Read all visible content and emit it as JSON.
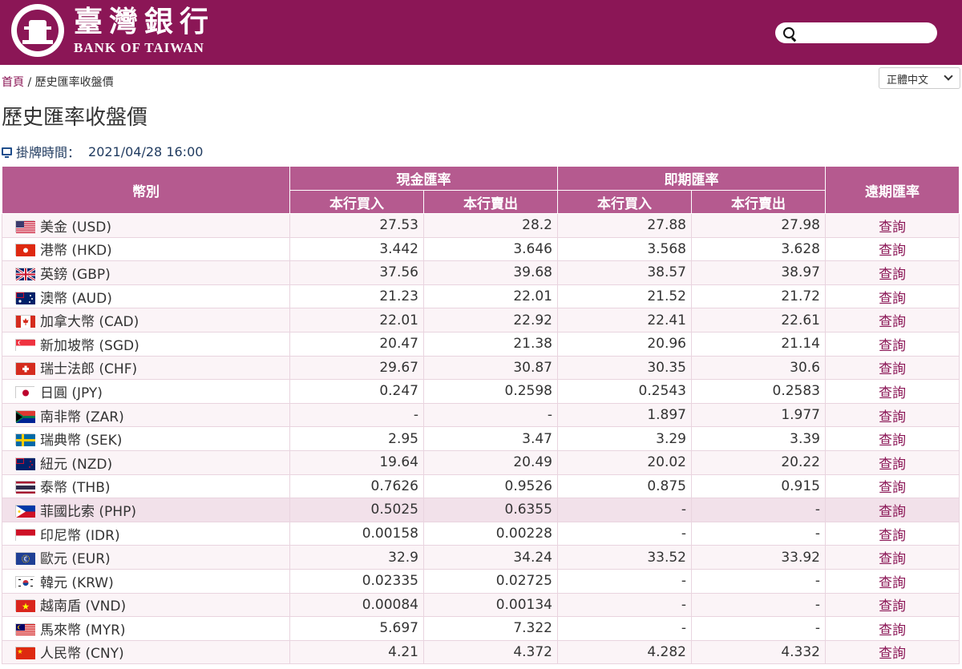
{
  "header": {
    "logo_cn": "臺灣銀行",
    "logo_en": "BANK OF TAIWAN",
    "search_placeholder": ""
  },
  "breadcrumb": {
    "home": "首頁",
    "separator": "/",
    "current": "歷史匯率收盤價"
  },
  "language": "正體中文",
  "page_title": "歷史匯率收盤價",
  "timestamp": {
    "label": "掛牌時間：",
    "value": "2021/04/28 16:00"
  },
  "table": {
    "headers": {
      "currency": "幣別",
      "cash": "現金匯率",
      "spot": "即期匯率",
      "forward": "遠期匯率",
      "buy": "本行買入",
      "sell": "本行賣出"
    },
    "rows": [
      {
        "flag": "us",
        "name": "美金 (USD)",
        "cash_buy": "27.53",
        "cash_sell": "28.2",
        "spot_buy": "27.88",
        "spot_sell": "27.98",
        "forward": "查詢"
      },
      {
        "flag": "hk",
        "name": "港幣 (HKD)",
        "cash_buy": "3.442",
        "cash_sell": "3.646",
        "spot_buy": "3.568",
        "spot_sell": "3.628",
        "forward": "查詢"
      },
      {
        "flag": "gb",
        "name": "英鎊 (GBP)",
        "cash_buy": "37.56",
        "cash_sell": "39.68",
        "spot_buy": "38.57",
        "spot_sell": "38.97",
        "forward": "查詢"
      },
      {
        "flag": "au",
        "name": "澳幣 (AUD)",
        "cash_buy": "21.23",
        "cash_sell": "22.01",
        "spot_buy": "21.52",
        "spot_sell": "21.72",
        "forward": "查詢"
      },
      {
        "flag": "ca",
        "name": "加拿大幣 (CAD)",
        "cash_buy": "22.01",
        "cash_sell": "22.92",
        "spot_buy": "22.41",
        "spot_sell": "22.61",
        "forward": "查詢"
      },
      {
        "flag": "sg",
        "name": "新加坡幣 (SGD)",
        "cash_buy": "20.47",
        "cash_sell": "21.38",
        "spot_buy": "20.96",
        "spot_sell": "21.14",
        "forward": "查詢"
      },
      {
        "flag": "ch",
        "name": "瑞士法郎 (CHF)",
        "cash_buy": "29.67",
        "cash_sell": "30.87",
        "spot_buy": "30.35",
        "spot_sell": "30.6",
        "forward": "查詢"
      },
      {
        "flag": "jp",
        "name": "日圓 (JPY)",
        "cash_buy": "0.247",
        "cash_sell": "0.2598",
        "spot_buy": "0.2543",
        "spot_sell": "0.2583",
        "forward": "查詢"
      },
      {
        "flag": "za",
        "name": "南非幣 (ZAR)",
        "cash_buy": "-",
        "cash_sell": "-",
        "spot_buy": "1.897",
        "spot_sell": "1.977",
        "forward": "查詢"
      },
      {
        "flag": "se",
        "name": "瑞典幣 (SEK)",
        "cash_buy": "2.95",
        "cash_sell": "3.47",
        "spot_buy": "3.29",
        "spot_sell": "3.39",
        "forward": "查詢"
      },
      {
        "flag": "nz",
        "name": "紐元 (NZD)",
        "cash_buy": "19.64",
        "cash_sell": "20.49",
        "spot_buy": "20.02",
        "spot_sell": "20.22",
        "forward": "查詢"
      },
      {
        "flag": "th",
        "name": "泰幣 (THB)",
        "cash_buy": "0.7626",
        "cash_sell": "0.9526",
        "spot_buy": "0.875",
        "spot_sell": "0.915",
        "forward": "查詢"
      },
      {
        "flag": "ph",
        "name": "菲國比索 (PHP)",
        "cash_buy": "0.5025",
        "cash_sell": "0.6355",
        "spot_buy": "-",
        "spot_sell": "-",
        "forward": "查詢"
      },
      {
        "flag": "id",
        "name": "印尼幣 (IDR)",
        "cash_buy": "0.00158",
        "cash_sell": "0.00228",
        "spot_buy": "-",
        "spot_sell": "-",
        "forward": "查詢"
      },
      {
        "flag": "eu",
        "name": "歐元 (EUR)",
        "cash_buy": "32.9",
        "cash_sell": "34.24",
        "spot_buy": "33.52",
        "spot_sell": "33.92",
        "forward": "查詢"
      },
      {
        "flag": "kr",
        "name": "韓元 (KRW)",
        "cash_buy": "0.02335",
        "cash_sell": "0.02725",
        "spot_buy": "-",
        "spot_sell": "-",
        "forward": "查詢"
      },
      {
        "flag": "vn",
        "name": "越南盾 (VND)",
        "cash_buy": "0.00084",
        "cash_sell": "0.00134",
        "spot_buy": "-",
        "spot_sell": "-",
        "forward": "查詢"
      },
      {
        "flag": "my",
        "name": "馬來幣 (MYR)",
        "cash_buy": "5.697",
        "cash_sell": "7.322",
        "spot_buy": "-",
        "spot_sell": "-",
        "forward": "查詢"
      },
      {
        "flag": "cn",
        "name": "人民幣 (CNY)",
        "cash_buy": "4.21",
        "cash_sell": "4.372",
        "spot_buy": "4.282",
        "spot_sell": "4.332",
        "forward": "查詢"
      }
    ],
    "highlighted_row": 12
  },
  "colors": {
    "brand": "#8b1656",
    "header_cell": "#b55a8f",
    "row_alt": "#fbf4f7",
    "row_highlight": "#f2e1ea"
  }
}
